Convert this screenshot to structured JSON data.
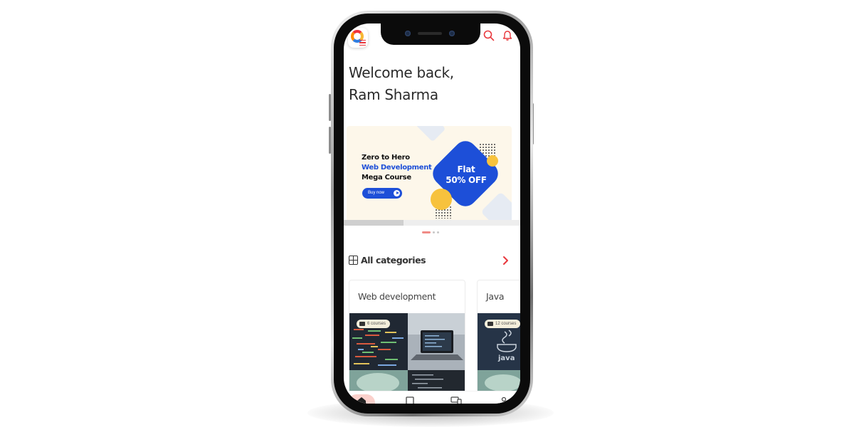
{
  "app": {
    "greeting_line1": "Welcome back,",
    "greeting_line2": "Ram Sharma"
  },
  "header": {
    "logo_icon": "app-logo-icon",
    "search_icon": "search-icon",
    "notification_icon": "bell-icon",
    "accent_color": "#e8383d"
  },
  "banner": {
    "line1": "Zero to Hero",
    "line2": "Web Development",
    "line3": "Mega Course",
    "button_label": "Buy now",
    "offer_line1": "Flat",
    "offer_line2": "50% OFF",
    "brand_color": "#1d4fd8",
    "pager_active_index": 0,
    "pager_count": 3
  },
  "categories": {
    "heading": "All categories",
    "items": [
      {
        "title": "Web development",
        "badge": "6 courses"
      },
      {
        "title": "Java",
        "badge": "12 courses"
      }
    ]
  },
  "bottom_nav": {
    "items": [
      {
        "icon": "home-icon",
        "active": true
      },
      {
        "icon": "book-icon",
        "active": false
      },
      {
        "icon": "devices-icon",
        "active": false
      },
      {
        "icon": "profile-icon",
        "active": false
      }
    ]
  }
}
